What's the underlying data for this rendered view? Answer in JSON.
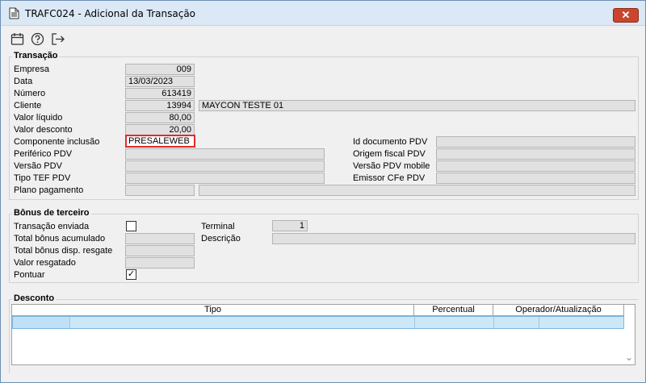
{
  "window": {
    "title": "TRAFC024 - Adicional da Transação",
    "close_label": "✕"
  },
  "toolbar": {
    "icons": [
      "calendar-icon",
      "help-icon",
      "exit-icon"
    ]
  },
  "transacao": {
    "title": "Transação",
    "empresa_label": "Empresa",
    "empresa": "009",
    "data_label": "Data",
    "data": "13/03/2023",
    "numero_label": "Número",
    "numero": "613419",
    "cliente_label": "Cliente",
    "cliente_codigo": "13994",
    "cliente_nome": "MAYCON TESTE 01",
    "valor_liquido_label": "Valor líquido",
    "valor_liquido": "80,00",
    "valor_desconto_label": "Valor desconto",
    "valor_desconto": "20,00",
    "componente_label": "Componente inclusão",
    "componente": "PRESALEWEB",
    "periferico_label": "Periférico PDV",
    "periferico": "",
    "versao_label": "Versão PDV",
    "versao": "",
    "tipo_tef_label": "Tipo TEF PDV",
    "tipo_tef": "",
    "plano_label": "Plano pagamento",
    "plano_codigo": "",
    "plano_desc": "",
    "id_documento_label": "Id documento PDV",
    "id_documento": "",
    "origem_fiscal_label": "Origem fiscal PDV",
    "origem_fiscal": "",
    "versao_mobile_label": "Versão PDV mobile",
    "versao_mobile": "",
    "emissor_label": "Emissor CFe PDV",
    "emissor": ""
  },
  "bonus": {
    "title": "Bônus de terceiro",
    "enviada_label": "Transação enviada",
    "enviada_checked": false,
    "acumulado_label": "Total bônus acumulado",
    "acumulado": "",
    "disp_label": "Total bônus disp. resgate",
    "disp": "",
    "resgatado_label": "Valor resgatado",
    "resgatado": "",
    "pontuar_label": "Pontuar",
    "pontuar_checked": true,
    "pontuar_mark": "✓",
    "terminal_label": "Terminal",
    "terminal": "1",
    "descricao_label": "Descrição",
    "descricao": ""
  },
  "desconto": {
    "title": "Desconto",
    "columns": [
      "Tipo",
      "Percentual",
      "Operador/Atualização"
    ],
    "scroll_down": "⌄"
  }
}
